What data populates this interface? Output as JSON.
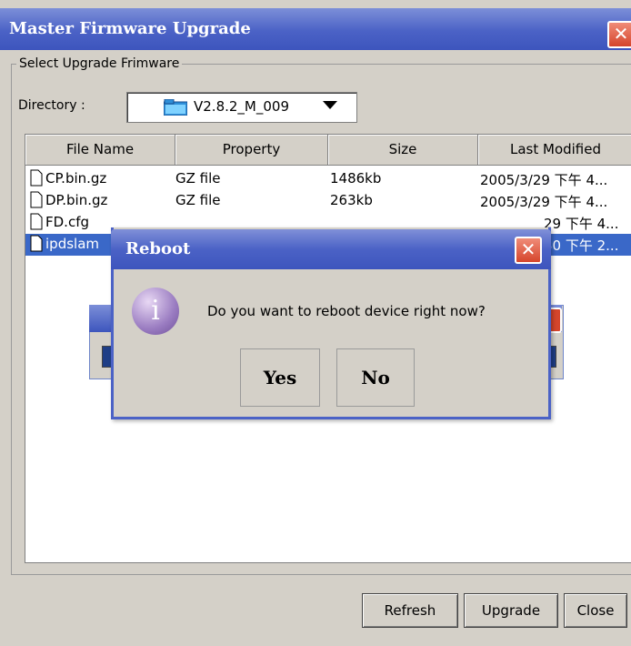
{
  "window": {
    "title": "Master Firmware Upgrade"
  },
  "group": {
    "title": "Select Upgrade Frimware"
  },
  "directory": {
    "label": "Directory :",
    "value": "V2.8.2_M_009"
  },
  "table": {
    "headers": [
      "File Name",
      "Property",
      "Size",
      "Last Modified"
    ],
    "rows": [
      {
        "name": "CP.bin.gz",
        "property": "GZ file",
        "size": "1486kb",
        "modified": "2005/3/29 下午 4...",
        "selected": false
      },
      {
        "name": "DP.bin.gz",
        "property": "GZ file",
        "size": "263kb",
        "modified": "2005/3/29 下午 4...",
        "selected": false
      },
      {
        "name": "FD.cfg",
        "property": "",
        "size": "",
        "modified": "29 下午 4...",
        "selected": false
      },
      {
        "name": "ipdslam",
        "property": "",
        "size": "",
        "modified": "30 下午 2...",
        "selected": true
      }
    ]
  },
  "buttons": {
    "refresh": "Refresh",
    "upgrade": "Upgrade",
    "close": "Close"
  },
  "dialog": {
    "title": "Reboot",
    "message": "Do you want to reboot device right now?",
    "yes": "Yes",
    "no": "No"
  },
  "icons": {
    "close": "close-icon",
    "info": "info-icon",
    "folder": "folder-icon",
    "file": "file-icon",
    "dropdown": "chevron-down-icon"
  },
  "colors": {
    "titlebar": "#4b62c6",
    "selection": "#3a68c8",
    "close": "#d5452c"
  }
}
